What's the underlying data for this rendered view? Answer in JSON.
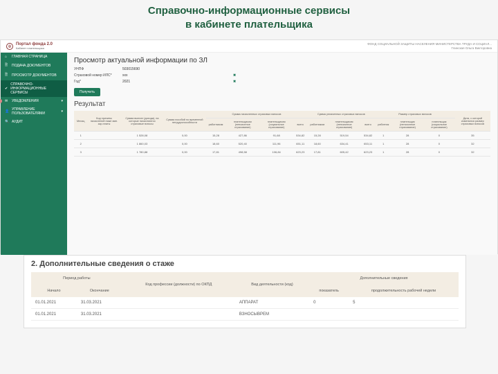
{
  "slide_title_line1": "Справочно-информационные сервисы",
  "slide_title_line2": "в кабинете плательщика",
  "brand": {
    "name": "Портал фонда 2.0",
    "sub": "Кабинет плательщика"
  },
  "header_right": {
    "line1": "ФОНД СОЦИАЛЬНОЙ ЗАЩИТЫ НАСЕЛЕНИЯ МИНИСТЕРСТВА ТРУДА И СОЦИАЛ...",
    "line2": "Глинская Ольга Викторовна"
  },
  "sidebar": {
    "items": [
      {
        "label": "ГЛАВНАЯ СТРАНИЦА",
        "icon": "⌂"
      },
      {
        "label": "ПОДАЧА ДОКУМЕНТОВ",
        "icon": "🗎"
      },
      {
        "label": "ПРОСМОТР ДОКУМЕНТОВ",
        "icon": "🗎"
      },
      {
        "label": "СПРАВОЧНО-ИНФОРМАЦИОННЫЕ СЕРВИСЫ",
        "icon": "✔",
        "active": true
      },
      {
        "label": "УВЕДОМЛЕНИЯ",
        "icon": "✉",
        "caret": "▾"
      },
      {
        "label": "УПРАВЛЕНИЕ ПОЛЬЗОВАТЕЛЯМИ",
        "icon": "👤",
        "caret": "▾"
      },
      {
        "label": "АУДИТ",
        "icon": "🔍"
      }
    ]
  },
  "panel": {
    "title": "Просмотр актуальной информации по ЗЛ",
    "unps_label": "УНПФ",
    "unps_value": "503015690",
    "ils_label": "Страховой номер ИЛС*",
    "ils_value": "xxx",
    "year_label": "Год*",
    "year_value": "2021",
    "clear": "✖",
    "get_btn": "Получить",
    "result_title": "Результат",
    "columns": {
      "month": "Месяц",
      "reason": "Код причины начислений ниже мин. зар.платы",
      "sum_vyplat": "Сумма выплат (дохода), на которые начисляются страховые взносы",
      "posobie": "Сумма пособий по временной нетрудоспособности",
      "nachis_group": "Сумма начисленных страховых взносов",
      "uplach_group": "Сумма уплаченных страховых взносов",
      "razmer_group": "Размер страховых взносов",
      "date": "Дата, с которой изменился размер страховых взносов",
      "rabotnik": "работником",
      "platel": "плательщиком (пенсионное страхование)",
      "platel_soc": "плательщиком (социальное страхование)",
      "vsego": "всего",
      "rabot": "работник",
      "plat_pens": "плательщик (пенсионное страхование)",
      "plat_soc": "плательщик (социальное страхование)"
    },
    "rows": [
      {
        "m": "1",
        "r": "",
        "sv": "1 528,08",
        "p": "0,00",
        "r1": "15,28",
        "r2": "427,86",
        "r3": "91,68",
        "v1": "534,82",
        "u1": "15,28",
        "u2": "519,54",
        "uv": "534,82",
        "rz1": "1",
        "rz2": "28",
        "rz3": "0",
        "d": "35"
      },
      {
        "m": "2",
        "r": "",
        "sv": "1 860,03",
        "p": "0,00",
        "r1": "18,60",
        "r2": "520,40",
        "r3": "111,96",
        "v1": "651,11",
        "u1": "18,60",
        "u2": "634,41",
        "uv": "653,11",
        "rz1": "1",
        "rz2": "28",
        "rz3": "0",
        "d": "32"
      },
      {
        "m": "3",
        "r": "",
        "sv": "1 780,88",
        "p": "0,00",
        "r1": "17,81",
        "r2": "498,58",
        "r3": "106,84",
        "v1": "623,23",
        "u1": "17,81",
        "u2": "605,42",
        "uv": "623,23",
        "rz1": "1",
        "rz2": "28",
        "rz3": "0",
        "d": "32"
      }
    ]
  },
  "section2": {
    "title": "2. Дополнительные сведения о стаже",
    "cols": {
      "period": "Период работы",
      "start": "Начало",
      "end": "Окончание",
      "prof": "Код профессии (должности) по ОКПД",
      "vid": "Вид деятельности (код)",
      "dop": "Дополнительные сведения",
      "pokaz": "показатель",
      "prod": "продолжительность рабочей недели"
    },
    "rows": [
      {
        "start": "01.01.2021",
        "end": "31.03.2021",
        "prof": "",
        "vid": "АППАРАТ",
        "pokaz": "0",
        "prod": "5"
      },
      {
        "start": "01.01.2021",
        "end": "31.03.2021",
        "prof": "",
        "vid": "ВЗНОСЫВРЕМ",
        "pokaz": "",
        "prod": ""
      }
    ]
  }
}
